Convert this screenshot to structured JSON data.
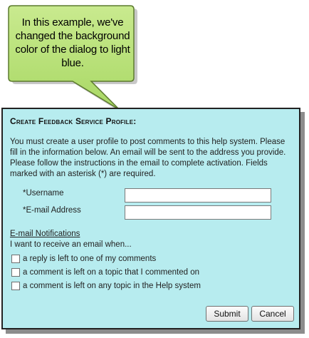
{
  "callout": {
    "text": "In this example, we've changed the background color of the dialog to light blue.",
    "fill_color": "#bde47c",
    "border_color": "#5c7a2e"
  },
  "dialog": {
    "background_color": "#b7ecef",
    "title": "Create Feedback Service Profile:",
    "intro": "You must create a user profile to post comments to this help system. Please fill in the information below. An email will be sent to the address you provide. Please follow the instructions in the email to complete activation. Fields marked with an asterisk (*) are required.",
    "fields": {
      "username_label": "*Username",
      "username_value": "",
      "email_label": "*E-mail Address",
      "email_value": ""
    },
    "notifications": {
      "heading": "E-mail Notifications",
      "subheading": "I want to receive an email when...",
      "options": [
        {
          "label": "a reply is left to one of my comments",
          "checked": false
        },
        {
          "label": "a comment is left on a topic that I commented on",
          "checked": false
        },
        {
          "label": "a comment is left on any topic in the Help system",
          "checked": false
        }
      ]
    },
    "buttons": {
      "submit": "Submit",
      "cancel": "Cancel"
    }
  }
}
